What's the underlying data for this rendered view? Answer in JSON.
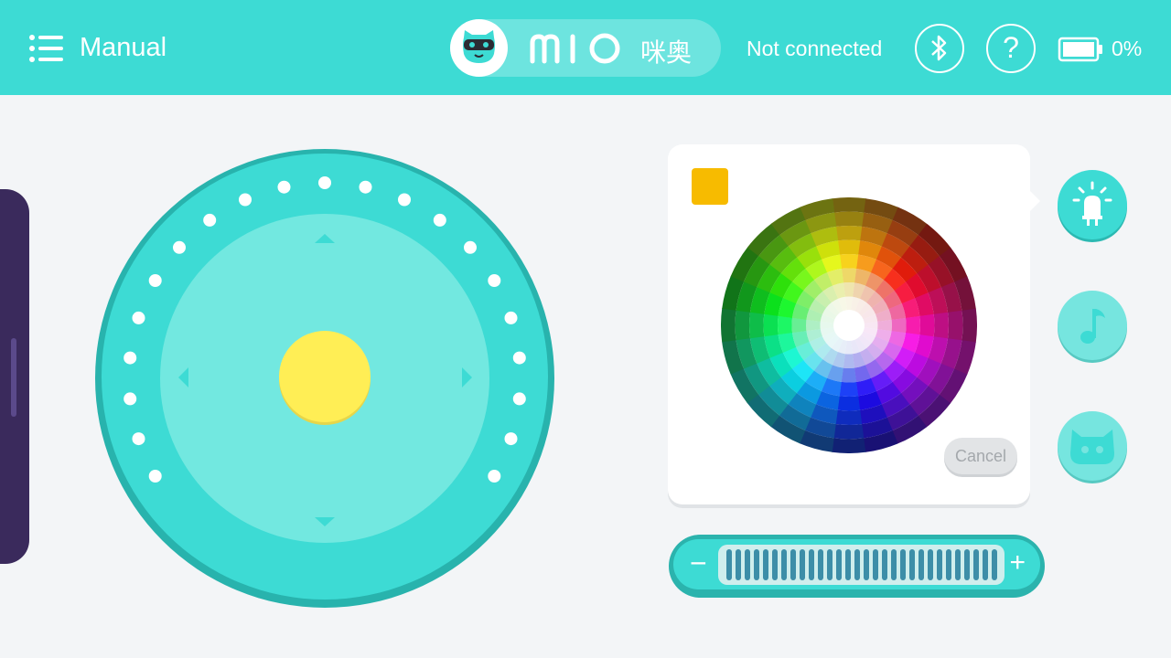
{
  "header": {
    "title": "Manual",
    "device_name": "咪奥",
    "connection_status": "Not connected",
    "help_label": "?",
    "battery_percent": "0%"
  },
  "icons": {
    "menu": "menu-list-icon",
    "avatar": "mio-cat-face-icon",
    "logo": "mio-logo",
    "bluetooth": "bluetooth-icon",
    "help": "question-mark-icon",
    "battery": "battery-icon",
    "led": "led-light-icon",
    "music": "music-note-icon",
    "face": "cat-face-icon"
  },
  "color_picker": {
    "selected_color": "#f7bb00",
    "cancel_label": "Cancel"
  },
  "slider": {
    "minus_label": "−",
    "plus_label": "+"
  },
  "colors": {
    "accent": "#3ddbd4",
    "joystick_knob": "#ffee55",
    "drawer": "#3a2a5c"
  }
}
